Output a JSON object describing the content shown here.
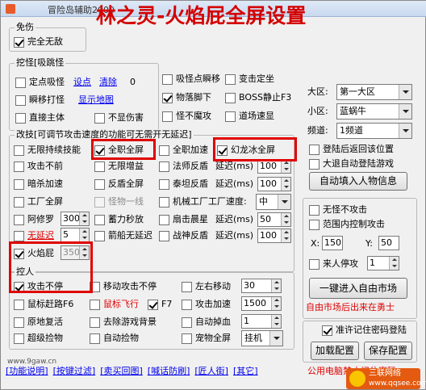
{
  "window": {
    "title": "冒险岛辅助2000"
  },
  "caption": "林之灵-火焰屁全屏设置",
  "groups": {
    "invincible": "免伤",
    "pickup": "挖怪[吸跳怪",
    "modify": "改技[可调节攻击速度的功能可无需开无延迟]",
    "control": "控人"
  },
  "invincible": {
    "full": "完全无敌"
  },
  "pickup": {
    "fixed_suck": "定点吸怪",
    "set_point": "设点",
    "clear": "清除",
    "count": "0",
    "teleport": "瞬移打怪",
    "show_map": "显示地图",
    "suck_point_move": "吸怪点瞬移",
    "find_point": "变击定坐",
    "drop_under": "物落脚下",
    "boss_still": "BOSS静止F3",
    "direct_body": "直接主体",
    "no_dmg": "不显伤害",
    "no_spawn": "怪不魔攻",
    "map_speed": "道场速显"
  },
  "modify": {
    "no_limit_skill": "无限持续技能",
    "full_job_screen": "全职全屏",
    "full_job_add": "全职加速",
    "dragon_ice_full": "幻龙冰全屏",
    "no_cd": "攻击不前",
    "infinite_boost": "无限增益",
    "mage_reflect": "法师反盾",
    "delay_ms": "延迟(ms)",
    "v1": "100",
    "dark_speed": "暗杀加速",
    "reflect_full": "反盾全屏",
    "reflect_speed": "泰坦反盾",
    "v2": "100",
    "worker_full": "工厂全屏",
    "monster_line": "怪物一线",
    "mech_speed": "机械工厂工厂速度:",
    "mech_val": "中",
    "ayo": "阿修罗",
    "ayo_val": "300",
    "charge_sec": "蓄力秒放",
    "fan_reflect": "扇击晨星",
    "v3": "50",
    "no_delay": "无延迟",
    "nd_val": "5",
    "arrow_nodelay": "箭船无延迟",
    "war_reflect": "战神反盾",
    "v4": "100",
    "fire_fart": "火焰屁",
    "ff_val": "350"
  },
  "control": {
    "attack_nonstop": "攻击不停",
    "move_attack": "移动攻击不停",
    "lr_move": "左右移动",
    "lr_val": "30",
    "mouse_path": "鼠标赶路F6",
    "mouse_fly": "鼠标飞行",
    "f7": "F7",
    "atk_speed": "攻击加速",
    "atk_val": "1500",
    "in_place_revive": "原地复活",
    "remove_bg": "去除游戏背景",
    "auto_drop": "自动掉血",
    "ad_val": "1",
    "super_pick": "超级捡物",
    "auto_pick": "自动捡物",
    "pet_full": "宠物全屏",
    "pet_mode": "挂机"
  },
  "right": {
    "region_label": "大区:",
    "region_val": "第一大区",
    "zone_label": "小区:",
    "zone_val": "蓝蜗牛",
    "channel_label": "频道:",
    "channel_val": "1频道",
    "login_return": "登陆后返回该位置",
    "big_login": "大退自动登陆游戏",
    "auto_fill": "自动填入人物信息",
    "no_kill": "无怪不攻击",
    "range_ctrl": "范围内控制攻击",
    "x_label": "X:",
    "x_val": "150",
    "y_label": "Y:",
    "y_val": "50",
    "someone_stop": "来人停攻",
    "ss_val": "1",
    "market": "一键进入自由市场",
    "market_note": "自由市场后出来在勇士",
    "remember_pw": "准许记住密码登陆",
    "load_cfg": "加载配置",
    "save_cfg": "保存配置",
    "footer_note": "公用电脑禁止记住密码"
  },
  "bottom_links": [
    "[功能说明]",
    "[按键过滤]",
    "[卖买回图]",
    "[喊话防刷]",
    "[匠人街]",
    "[其它]"
  ],
  "bottom_site": "www.9gaw.cn",
  "watermark": {
    "line1": "三联网络",
    "line2": "www.qqsee.com"
  },
  "colors": {
    "highlight": "#e00000",
    "link": "#0000ee"
  }
}
